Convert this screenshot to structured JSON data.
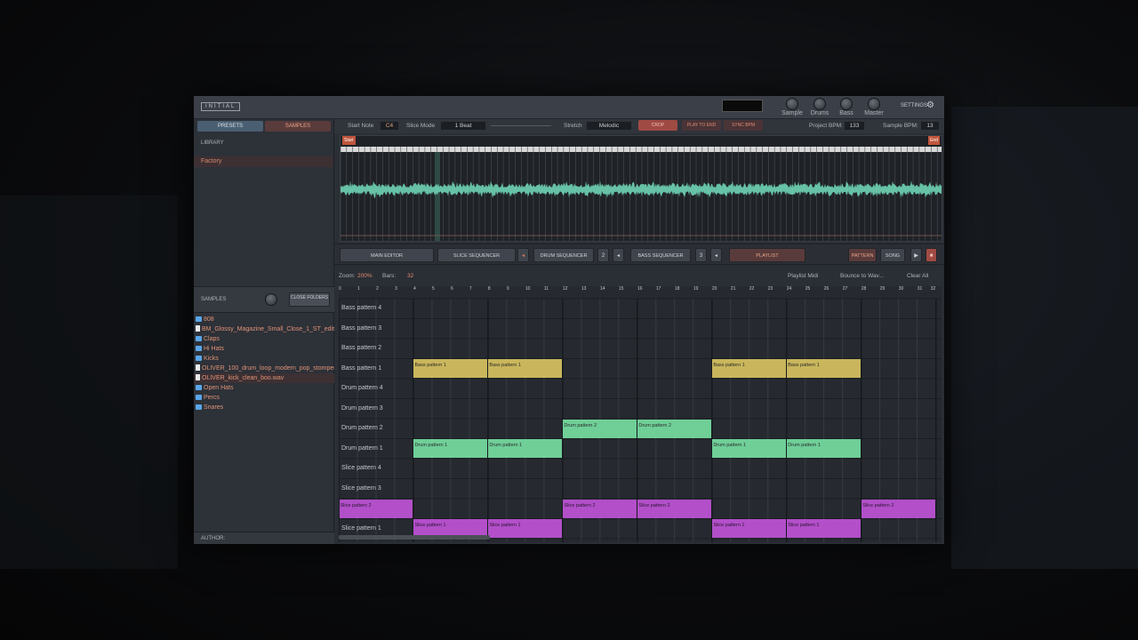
{
  "app": {
    "logo": "INITIAL",
    "settings_label": "SETTINGS"
  },
  "knobs": [
    "Sample",
    "Drums",
    "Bass",
    "Master"
  ],
  "sidebar": {
    "tabs": [
      "PRESETS",
      "SAMPLES"
    ],
    "library_title": "LIBRARY",
    "library_item": "Factory",
    "samples_title": "SAMPLES",
    "close_folders": "CLOSE FOLDERS",
    "files": [
      {
        "name": "808",
        "type": "folder",
        "selected": false
      },
      {
        "name": "BM_Glossy_Magazine_Small_Close_1_ST_edit_.wav",
        "type": "file",
        "selected": false
      },
      {
        "name": "Claps",
        "type": "folder",
        "selected": false
      },
      {
        "name": "Hi Hats",
        "type": "folder",
        "selected": false
      },
      {
        "name": "Kicks",
        "type": "folder",
        "selected": false
      },
      {
        "name": "OLIVER_100_drum_loop_modern_pop_stomper.wav",
        "type": "file",
        "selected": false
      },
      {
        "name": "OLIVER_kick_clean_boo.wav",
        "type": "file",
        "selected": true
      },
      {
        "name": "Open Hats",
        "type": "folder",
        "selected": false
      },
      {
        "name": "Percs",
        "type": "folder",
        "selected": false
      },
      {
        "name": "Snares",
        "type": "folder",
        "selected": false
      }
    ],
    "author_label": "AUTHOR:"
  },
  "controls": {
    "start_note_label": "Start Note",
    "start_note": "C4",
    "slice_mode_label": "Slice Mode",
    "slice_mode": "1 Beat",
    "stretch_label": "Stretch",
    "stretch": "Melodic",
    "crop": "CROP",
    "play_to_end": "PLAY TO END",
    "sync_bpm": "SYNC BPM",
    "project_bpm_label": "Project BPM:",
    "project_bpm": "133",
    "sample_bpm_label": "Sample BPM:",
    "sample_bpm": "13"
  },
  "waveform": {
    "start_label": "Start",
    "end_label": "End",
    "first_note": "C4"
  },
  "nav": {
    "main_editor": "MAIN EDITOR",
    "slice_sequencer": "SLICE SEQUENCER",
    "drum_sequencer": "DRUM SEQUENCER",
    "drum_num": "2",
    "bass_sequencer": "BASS SEQUENCER",
    "bass_num": "3",
    "playlist": "PLAYLIST",
    "pattern": "PATTERN",
    "song": "SONG"
  },
  "zoom": {
    "zoom_label": "Zoom:",
    "zoom_value": "200%",
    "bars_label": "Bars:",
    "bars_value": "32",
    "playlist_midi": "Playlist Midi",
    "bounce": "Bounce to Wav...",
    "clear_all": "Clear All"
  },
  "colors": {
    "bass": "#c9b65c",
    "drum": "#6fcf97",
    "slice": "#b24fc9",
    "accent": "#c0553c"
  },
  "tracks": [
    "Bass pattern 4",
    "Bass pattern 3",
    "Bass pattern 2",
    "Bass pattern 1",
    "Drum pattern 4",
    "Drum pattern 3",
    "Drum pattern 2",
    "Drum pattern 1",
    "Slice pattern 4",
    "Slice pattern 3",
    "Slice pattern 2",
    "Slice pattern 1"
  ],
  "blocks": [
    {
      "track": 3,
      "bar": 4,
      "len": 4,
      "kind": "bass",
      "label": "Bass pattern 1"
    },
    {
      "track": 3,
      "bar": 8,
      "len": 4,
      "kind": "bass",
      "label": "Bass pattern 1"
    },
    {
      "track": 3,
      "bar": 20,
      "len": 4,
      "kind": "bass",
      "label": "Bass pattern 1"
    },
    {
      "track": 3,
      "bar": 24,
      "len": 4,
      "kind": "bass",
      "label": "Bass pattern 1"
    },
    {
      "track": 6,
      "bar": 12,
      "len": 4,
      "kind": "drum",
      "label": "Drum pattern 2"
    },
    {
      "track": 6,
      "bar": 16,
      "len": 4,
      "kind": "drum",
      "label": "Drum pattern 2"
    },
    {
      "track": 7,
      "bar": 4,
      "len": 4,
      "kind": "drum",
      "label": "Drum pattern 1"
    },
    {
      "track": 7,
      "bar": 8,
      "len": 4,
      "kind": "drum",
      "label": "Drum pattern 1"
    },
    {
      "track": 7,
      "bar": 20,
      "len": 4,
      "kind": "drum",
      "label": "Drum pattern 1"
    },
    {
      "track": 7,
      "bar": 24,
      "len": 4,
      "kind": "drum",
      "label": "Drum pattern 1"
    },
    {
      "track": 10,
      "bar": 0,
      "len": 4,
      "kind": "slice",
      "label": "Slice pattern 2"
    },
    {
      "track": 10,
      "bar": 12,
      "len": 4,
      "kind": "slice",
      "label": "Slice pattern 2"
    },
    {
      "track": 10,
      "bar": 16,
      "len": 4,
      "kind": "slice",
      "label": "Slice pattern 2"
    },
    {
      "track": 10,
      "bar": 28,
      "len": 4,
      "kind": "slice",
      "label": "Slice pattern 2"
    },
    {
      "track": 11,
      "bar": 4,
      "len": 4,
      "kind": "slice",
      "label": "Slice pattern 1"
    },
    {
      "track": 11,
      "bar": 8,
      "len": 4,
      "kind": "slice",
      "label": "Slice pattern 1"
    },
    {
      "track": 11,
      "bar": 20,
      "len": 4,
      "kind": "slice",
      "label": "Slice pattern 1"
    },
    {
      "track": 11,
      "bar": 24,
      "len": 4,
      "kind": "slice",
      "label": "Slice pattern 1"
    }
  ]
}
